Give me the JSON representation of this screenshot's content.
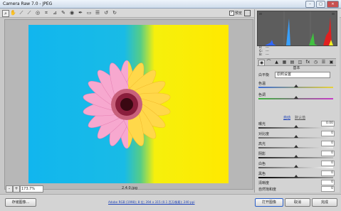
{
  "window": {
    "title": "Camera Raw 7.0 - JPEG",
    "controls": [
      "minimize-icon",
      "maximize-icon",
      "close-icon"
    ]
  },
  "toolbar": {
    "tools": [
      "zoom-icon",
      "hand-icon",
      "white-balance-icon",
      "color-sampler-icon",
      "target-adjust-icon",
      "crop-icon",
      "straighten-icon",
      "spot-removal-icon",
      "red-eye-icon",
      "adjustment-brush-icon",
      "graduated-filter-icon",
      "preferences-icon",
      "rotate-ccw-icon",
      "rotate-cw-icon"
    ],
    "preview_label": "预览",
    "preview_checked": true
  },
  "statusbar": {
    "zoom_minus": "-",
    "zoom_plus": "+",
    "zoom_value": "173.7%",
    "filename": "2.4.0.jpg"
  },
  "bottom": {
    "save_image": "存储图像...",
    "workflow_options": "Adobe RGB (1998); 8 位; 394 x 315 (0.1 百万像素); 240 ppi",
    "open_image": "打开图像",
    "cancel": "取消",
    "done": "完成"
  },
  "histogram": {
    "r_label": "R:",
    "r_value": "---",
    "g_label": "G:",
    "g_value": "---",
    "b_label": "B:",
    "b_value": "---"
  },
  "panel": {
    "name": "基本",
    "white_balance_label": "白平衡",
    "white_balance_value": "原照设置",
    "auto": "自动",
    "default": "默认值",
    "sliders": [
      {
        "label": "色温",
        "value": "",
        "level": 0.5
      },
      {
        "label": "色调",
        "value": "",
        "level": 0.5
      },
      {
        "label": "曝光",
        "value": "0.00",
        "level": 0.5
      },
      {
        "label": "对比度",
        "value": "0",
        "level": 0.5
      },
      {
        "label": "高光",
        "value": "0",
        "level": 0.5
      },
      {
        "label": "阴影",
        "value": "0",
        "level": 0.5
      },
      {
        "label": "白色",
        "value": "0",
        "level": 0.5
      },
      {
        "label": "黑色",
        "value": "0",
        "level": 0.5
      },
      {
        "label": "清晰度",
        "value": "0",
        "level": 0.5
      },
      {
        "label": "自然饱和度",
        "value": "0",
        "level": 0.5
      }
    ]
  },
  "colors": {
    "image_blue": "#11b6ee",
    "image_yellow": "#ffe900",
    "petal_pink": "#f7a8cf",
    "petal_yellow": "#ffd84a",
    "flower_center": "#7a1330",
    "open_button_border": "#2b5fc7"
  }
}
